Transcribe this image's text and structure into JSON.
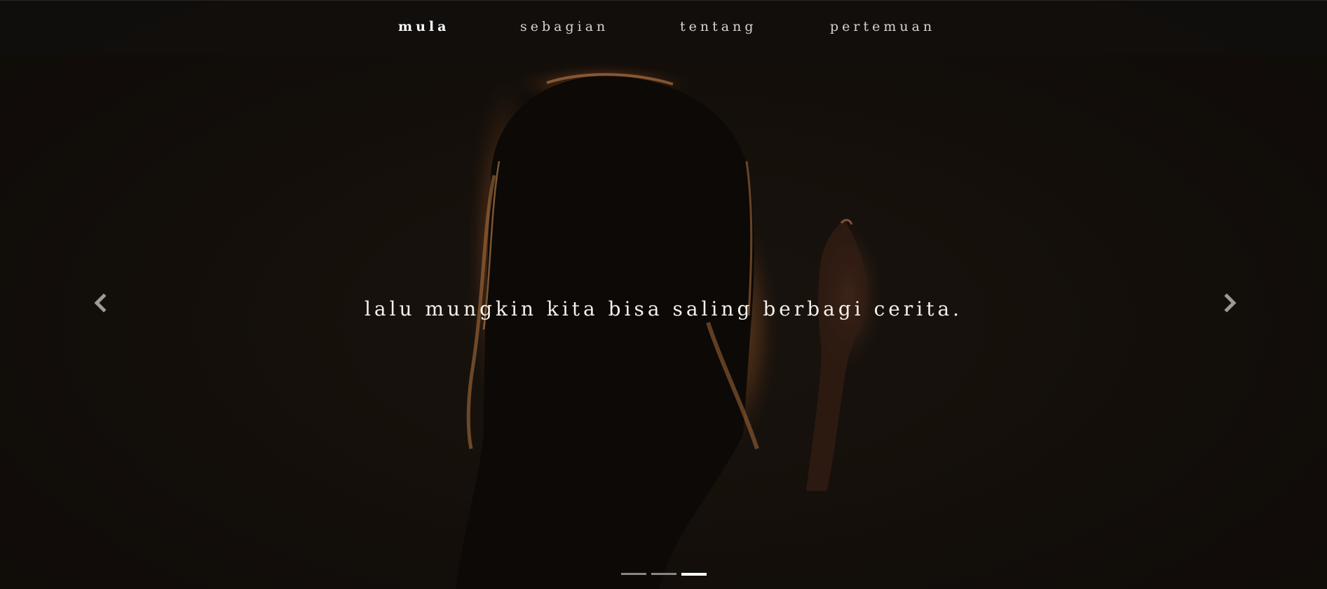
{
  "nav": {
    "items": [
      {
        "label": "mula",
        "active": true
      },
      {
        "label": "sebagian",
        "active": false
      },
      {
        "label": "tentang",
        "active": false
      },
      {
        "label": "pertemuan",
        "active": false
      }
    ]
  },
  "slide": {
    "caption": "lalu mungkin kita bisa saling berbagi cerita.",
    "active_index": 3,
    "total": 3
  },
  "controls": {
    "prev_icon": "chevron-left-icon",
    "next_icon": "chevron-right-icon"
  },
  "colors": {
    "background": "#140f0b",
    "hair_highlight": "#c97a3e",
    "text": "#f4efe9",
    "indicator_active": "#ffffff",
    "indicator_inactive": "#8a8682"
  }
}
